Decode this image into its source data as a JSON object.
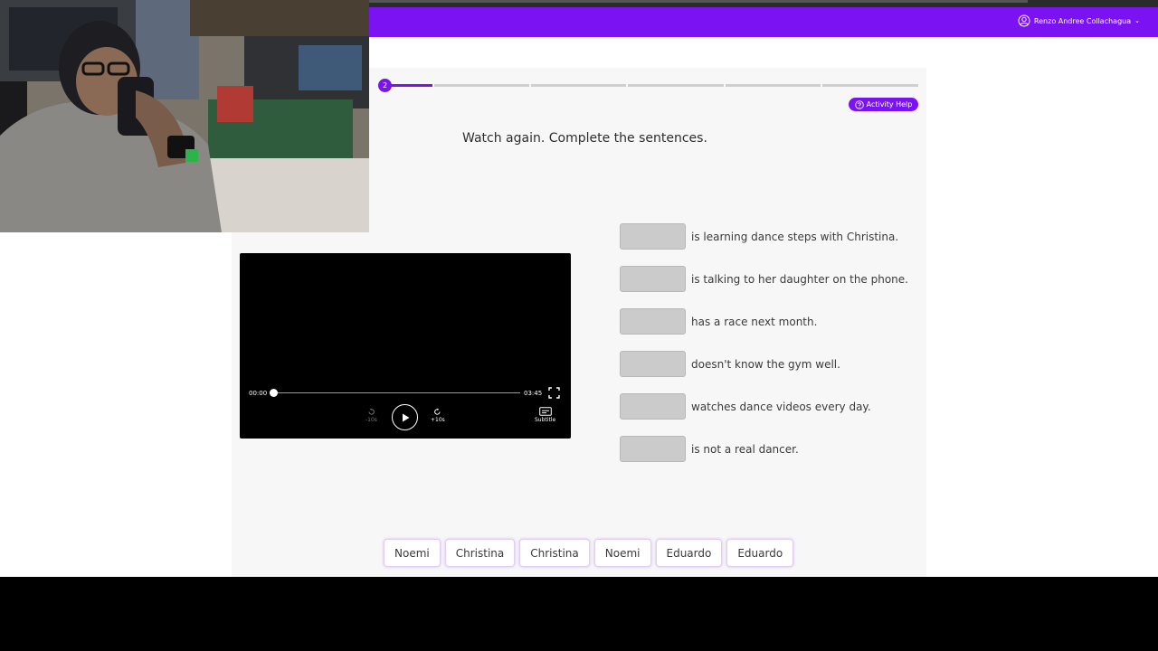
{
  "header": {
    "user_name": "Renzo Andree Collachagua",
    "user_icon": "user-circle-icon",
    "menu_icon": "chevron-down-icon"
  },
  "progress": {
    "current_step": "2",
    "total_steps": 6
  },
  "activity_help": {
    "label": "Activity Help",
    "icon": "question-circle-icon"
  },
  "instruction": "Watch again. Complete the sentences.",
  "video": {
    "current_time": "00:00",
    "duration": "03:45",
    "progress": 0,
    "back_label": "-10s",
    "forward_label": "+10s",
    "subtitle_label": "Subtitle",
    "icons": [
      "rewind-icon",
      "play-icon",
      "forward-icon",
      "subtitle-icon",
      "fullscreen-icon"
    ]
  },
  "sentences": [
    "is learning dance steps with Christina.",
    "is talking to her daughter on the phone.",
    "has a race next month.",
    "doesn't know the gym well.",
    "watches dance videos every day.",
    "is not a real dancer."
  ],
  "word_bank": [
    "Noemi",
    "Christina",
    "Christina",
    "Noemi",
    "Eduardo",
    "Eduardo"
  ],
  "colors": {
    "accent": "#7a12f2",
    "panel": "#f7f7f7",
    "drop_zone": "#cbcbcb"
  }
}
